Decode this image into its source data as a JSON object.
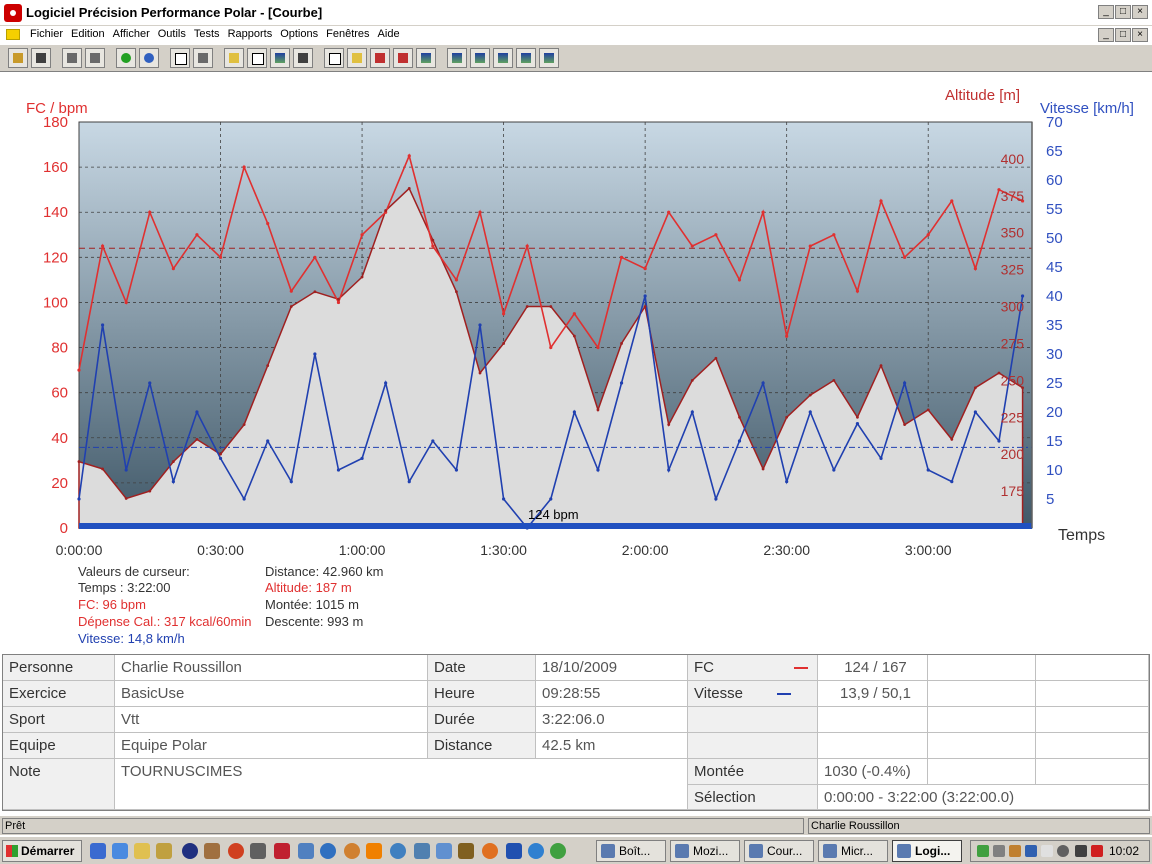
{
  "window": {
    "title": "Logiciel Précision Performance Polar - [Courbe]",
    "controls": [
      "_",
      "□",
      "×"
    ]
  },
  "menu": {
    "items": [
      "Fichier",
      "Edition",
      "Afficher",
      "Outils",
      "Tests",
      "Rapports",
      "Options",
      "Fenêtres",
      "Aide"
    ]
  },
  "toolbar": {
    "icons": [
      "open-icon",
      "save-icon",
      "print-icon",
      "copy-icon",
      "sync-icon",
      "web-icon",
      "window-icon",
      "book-icon",
      "chart-area-icon",
      "table-icon",
      "chart-bar-icon",
      "grid-icon",
      "zoom-icon",
      "chart-line-icon",
      "arrow-icon",
      "swap-icon",
      "chart-compare-icon",
      "bar-chart-1-icon",
      "bar-chart-2-icon",
      "bar-chart-3-icon",
      "bar-chart-4-icon",
      "bar-chart-5-icon"
    ]
  },
  "chart": {
    "left_axis_title": "FC / bpm",
    "altitude_axis_title": "Altitude [m]",
    "speed_axis_title": "Vitesse [km/h]",
    "x_axis_title": "Temps",
    "hr_ticks": [
      "180",
      "160",
      "140",
      "120",
      "100",
      "80",
      "60",
      "40",
      "20",
      "0"
    ],
    "alt_ticks": [
      "400",
      "375",
      "350",
      "325",
      "300",
      "275",
      "250",
      "225",
      "200",
      "175"
    ],
    "speed_ticks": [
      "70",
      "65",
      "60",
      "55",
      "50",
      "45",
      "40",
      "35",
      "30",
      "25",
      "20",
      "15",
      "10",
      "5"
    ],
    "time_ticks": [
      "0:00:00",
      "0:30:00",
      "1:00:00",
      "1:30:00",
      "2:00:00",
      "2:30:00",
      "3:00:00"
    ],
    "avg_label": "124 bpm",
    "colors": {
      "hr": "#e03030",
      "speed": "#2040b0",
      "altitude_line": "#a02020",
      "altitude_fill": "#dcdcdc",
      "bg_top": "#c8d8e4",
      "bg_bottom": "#405868"
    }
  },
  "chart_data": {
    "type": "line",
    "title": "",
    "xlabel": "Temps",
    "x_unit": "minutes",
    "xlim": [
      0,
      202
    ],
    "x": [
      0,
      5,
      10,
      15,
      20,
      25,
      30,
      35,
      40,
      45,
      50,
      55,
      60,
      65,
      70,
      75,
      80,
      85,
      90,
      95,
      100,
      105,
      110,
      115,
      120,
      125,
      130,
      135,
      140,
      145,
      150,
      155,
      160,
      165,
      170,
      175,
      180,
      185,
      190,
      195,
      200
    ],
    "series": [
      {
        "name": "FC / bpm",
        "axis": "left",
        "ylim": [
          0,
          180
        ],
        "values": [
          70,
          125,
          100,
          140,
          115,
          130,
          120,
          160,
          135,
          105,
          120,
          100,
          130,
          140,
          165,
          125,
          110,
          140,
          95,
          125,
          80,
          95,
          80,
          120,
          115,
          140,
          125,
          130,
          110,
          140,
          85,
          125,
          130,
          105,
          145,
          120,
          130,
          145,
          115,
          150,
          145
        ]
      },
      {
        "name": "Vitesse [km/h]",
        "axis": "right",
        "ylim": [
          0,
          70
        ],
        "values": [
          5,
          35,
          10,
          25,
          8,
          20,
          12,
          5,
          15,
          8,
          30,
          10,
          12,
          25,
          8,
          15,
          10,
          35,
          5,
          0,
          5,
          20,
          10,
          25,
          40,
          10,
          20,
          5,
          15,
          25,
          8,
          20,
          10,
          18,
          12,
          25,
          10,
          8,
          20,
          15,
          40
        ]
      },
      {
        "name": "Altitude [m]",
        "axis": "altitude",
        "ylim": [
          150,
          425
        ],
        "values": [
          195,
          190,
          170,
          175,
          195,
          210,
          200,
          220,
          260,
          300,
          310,
          305,
          320,
          365,
          380,
          345,
          310,
          255,
          275,
          300,
          300,
          280,
          230,
          275,
          300,
          220,
          250,
          265,
          225,
          190,
          225,
          240,
          250,
          225,
          260,
          220,
          230,
          210,
          245,
          255,
          245
        ]
      }
    ],
    "reference_lines": [
      {
        "series": "FC / bpm",
        "value": 124,
        "label": "124 bpm"
      },
      {
        "series": "Vitesse [km/h]",
        "value": 13.9
      }
    ],
    "legend": "none",
    "grid": true
  },
  "cursor": {
    "header": "Valeurs de curseur:",
    "temps": "Temps : 3:22:00",
    "fc": "FC: 96 bpm",
    "depense": "Dépense Cal.: 317 kcal/60min",
    "vitesse": "Vitesse: 14,8 km/h",
    "distance": "Distance: 42.960 km",
    "altitude": "Altitude: 187 m",
    "montee": "Montée: 1015 m",
    "descente": "Descente: 993 m"
  },
  "info": {
    "personne_label": "Personne",
    "personne": "Charlie Roussillon",
    "exercice_label": "Exercice",
    "exercice": "BasicUse",
    "sport_label": "Sport",
    "sport": "Vtt",
    "equipe_label": "Equipe",
    "equipe": "Equipe Polar",
    "note_label": "Note",
    "note": "TOURNUSCIMES",
    "date_label": "Date",
    "date": "18/10/2009",
    "heure_label": "Heure",
    "heure": "09:28:55",
    "duree_label": "Durée",
    "duree": "3:22:06.0",
    "distance_label": "Distance",
    "distance": "42.5 km",
    "fc_label": "FC",
    "fc": "124 / 167",
    "vitesse_label": "Vitesse",
    "vitesse": "13,9 / 50,1",
    "montee_label": "Montée",
    "montee": "1030 (-0.4%)",
    "selection_label": "Sélection",
    "selection": "0:00:00 - 3:22:00 (3:22:00.0)"
  },
  "status": {
    "left": "Prêt",
    "right": "Charlie Roussillon"
  },
  "taskbar": {
    "start": "Démarrer",
    "tasks": [
      "Boît...",
      "Mozi...",
      "Cour...",
      "Micr...",
      "Logi..."
    ],
    "clock": "10:02"
  }
}
